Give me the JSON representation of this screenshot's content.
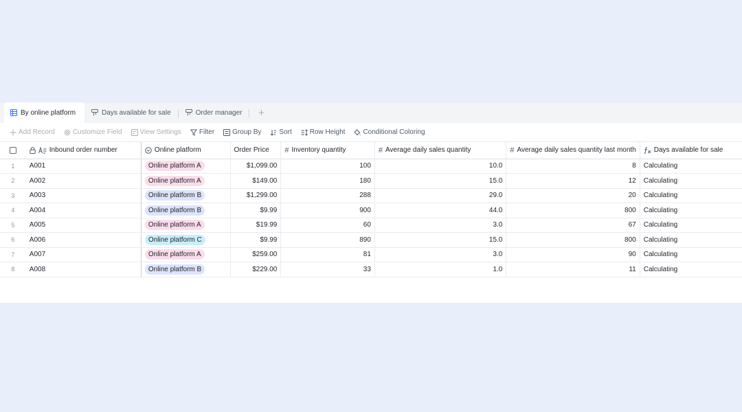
{
  "tabs": [
    {
      "label": "By online platform",
      "active": true
    },
    {
      "label": "Days available for sale",
      "active": false
    },
    {
      "label": "Order manager",
      "active": false
    }
  ],
  "toolbar": {
    "add_record": "Add Record",
    "customize_field": "Customize Field",
    "view_settings": "View Settings",
    "filter": "Filter",
    "group_by": "Group By",
    "sort": "Sort",
    "row_height": "Row Height",
    "conditional_coloring": "Conditional Coloring"
  },
  "columns": {
    "order_number": "Inbound order number",
    "platform": "Online platform",
    "price": "Order Price",
    "inventory": "Inventory quantity",
    "avg_daily": "Average daily sales quantity",
    "avg_daily_last_month": "Average daily sales quantity last month",
    "days_available": "Days available for sale"
  },
  "platform_colors": {
    "Online platform A": "#fbdcea",
    "Online platform B": "#dde3fb",
    "Online platform C": "#c9eefa"
  },
  "rows": [
    {
      "idx": "1",
      "order": "A001",
      "platform": "Online platform A",
      "price": "$1,099.00",
      "inventory": "100",
      "avg": "10.0",
      "last": "8",
      "days": "Calculating"
    },
    {
      "idx": "2",
      "order": "A002",
      "platform": "Online platform A",
      "price": "$149.00",
      "inventory": "180",
      "avg": "15.0",
      "last": "12",
      "days": "Calculating"
    },
    {
      "idx": "3",
      "order": "A003",
      "platform": "Online platform B",
      "price": "$1,299.00",
      "inventory": "288",
      "avg": "29.0",
      "last": "20",
      "days": "Calculating"
    },
    {
      "idx": "4",
      "order": "A004",
      "platform": "Online platform B",
      "price": "$9.99",
      "inventory": "900",
      "avg": "44.0",
      "last": "800",
      "days": "Calculating"
    },
    {
      "idx": "5",
      "order": "A005",
      "platform": "Online platform A",
      "price": "$19.99",
      "inventory": "60",
      "avg": "3.0",
      "last": "67",
      "days": "Calculating"
    },
    {
      "idx": "6",
      "order": "A006",
      "platform": "Online platform C",
      "price": "$9.99",
      "inventory": "890",
      "avg": "15.0",
      "last": "800",
      "days": "Calculating"
    },
    {
      "idx": "7",
      "order": "A007",
      "platform": "Online platform A",
      "price": "$259.00",
      "inventory": "81",
      "avg": "3.0",
      "last": "90",
      "days": "Calculating"
    },
    {
      "idx": "8",
      "order": "A008",
      "platform": "Online platform B",
      "price": "$229.00",
      "inventory": "33",
      "avg": "1.0",
      "last": "11",
      "days": "Calculating"
    }
  ]
}
